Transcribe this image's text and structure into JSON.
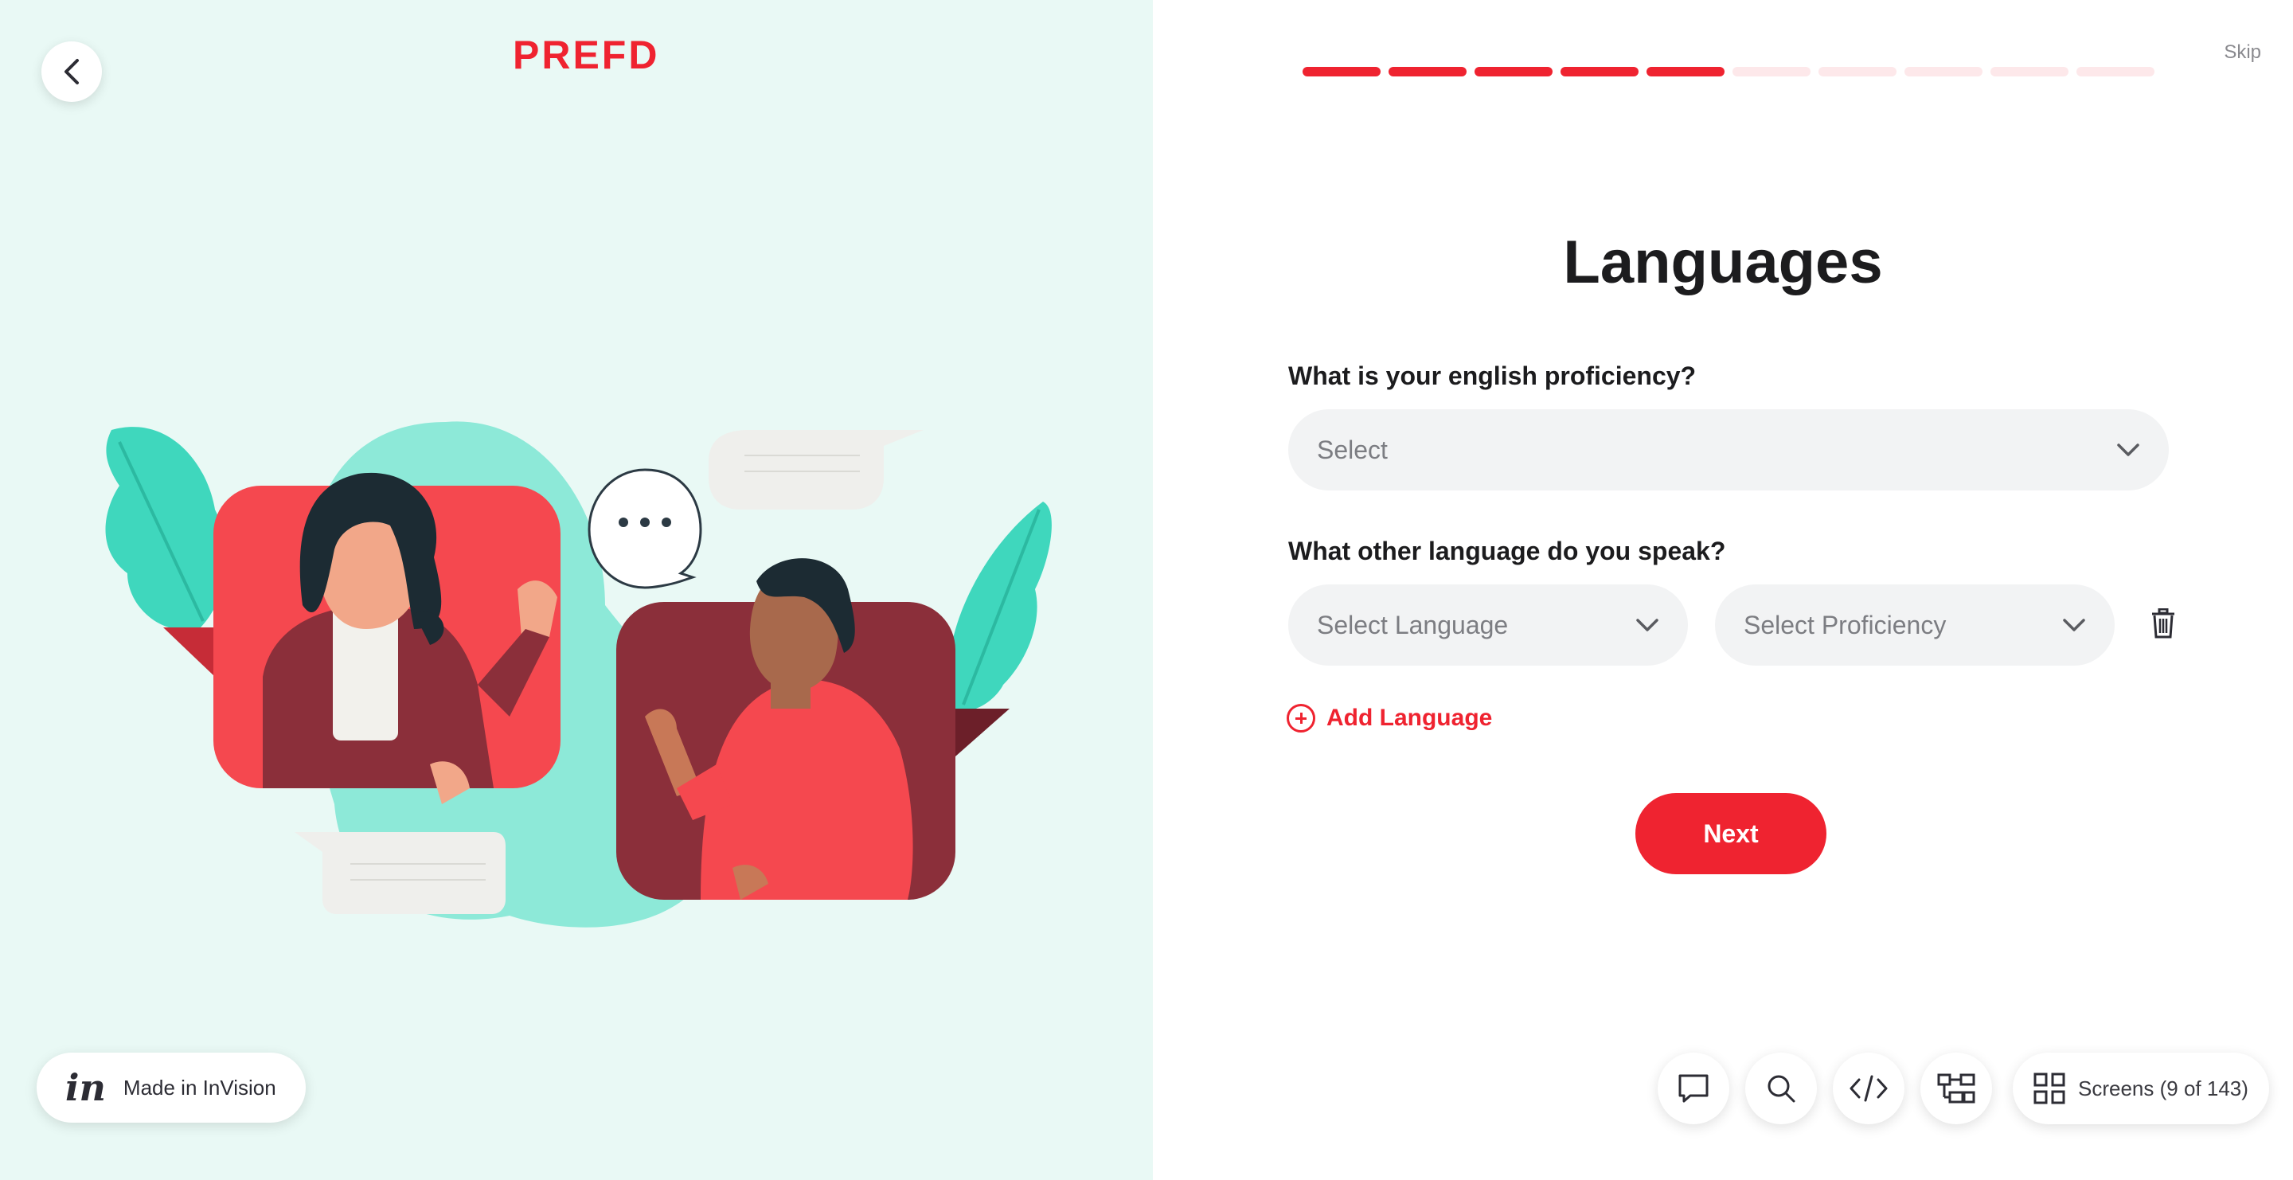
{
  "brand": {
    "logo": "PREFD"
  },
  "nav": {
    "back_icon": "chevron-left-icon",
    "skip_label": "Skip"
  },
  "progress": {
    "total_steps": 10,
    "completed_steps": 5,
    "active_color": "#ef2330",
    "inactive_color": "#fde8ea"
  },
  "page": {
    "title": "Languages"
  },
  "form": {
    "english_label": "What is your english proficiency?",
    "english_select_placeholder": "Select",
    "other_label": "What other language do you speak?",
    "language_select_placeholder": "Select Language",
    "proficiency_select_placeholder": "Select Proficiency",
    "add_language_label": "Add Language",
    "next_label": "Next"
  },
  "invision": {
    "badge_label": "Made in InVision",
    "logo_text": "in"
  },
  "toolbar": {
    "icons": [
      "comment-icon",
      "search-icon",
      "code-icon",
      "flow-map-icon",
      "grid-icon"
    ],
    "screens_label": "Screens (9 of 143)"
  },
  "colors": {
    "accent": "#ef2330",
    "left_background": "#e9f9f5",
    "teal": "#8de9d8",
    "maroon": "#8b2f3a"
  }
}
